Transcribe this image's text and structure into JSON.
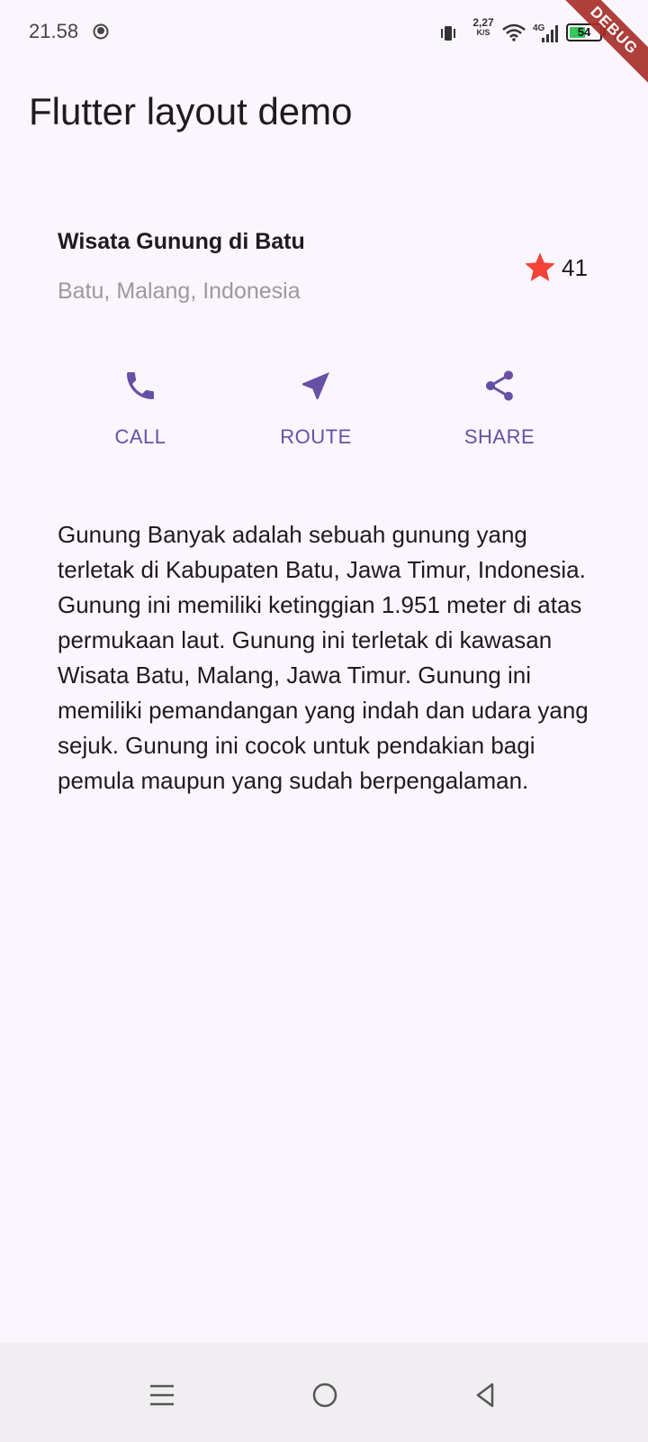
{
  "status_bar": {
    "time": "21.58",
    "net_speed_value": "2,27",
    "net_speed_unit": "K/S",
    "network_type": "4G",
    "battery_level": "54",
    "battery_fraction": 0.54
  },
  "debug_banner": "DEBUG",
  "app_bar": {
    "title": "Flutter layout demo"
  },
  "title_section": {
    "name": "Wisata Gunung di Batu",
    "location": "Batu, Malang, Indonesia",
    "rating_count": "41"
  },
  "actions": [
    {
      "label": "CALL",
      "icon": "phone-icon"
    },
    {
      "label": "ROUTE",
      "icon": "near-me-icon"
    },
    {
      "label": "SHARE",
      "icon": "share-icon"
    }
  ],
  "description": "Gunung Banyak adalah sebuah gunung yang terletak di Kabupaten Batu, Jawa Timur, Indonesia. Gunung ini memiliki ketinggian 1.951 meter di atas permukaan laut. Gunung ini terletak di kawasan Wisata Batu, Malang, Jawa Timur. Gunung ini memiliki pemandangan yang indah dan udara yang sejuk. Gunung ini cocok untuk pendakian bagi pemula maupun yang sudah berpengalaman.",
  "colors": {
    "background": "#FBF5FD",
    "accent": "#6750A4",
    "star": "#F44336",
    "subtitle": "#9B999E"
  }
}
